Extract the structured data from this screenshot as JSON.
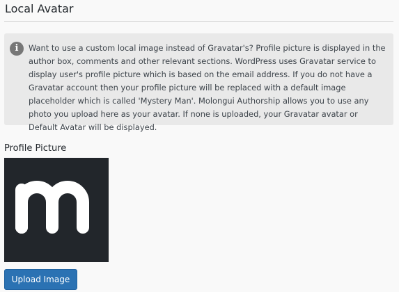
{
  "section": {
    "title": "Local Avatar"
  },
  "notice": {
    "icon": "info-icon",
    "icon_glyph": "i",
    "text": "Want to use a custom local image instead of Gravatar's? Profile picture is displayed in the author box, comments and other relevant sections. WordPress uses Gravatar service to display user's profile picture which is based on the email address. If you do not have a Gravatar account then your profile picture will be replaced with a default image placeholder which is called 'Mystery Man'. Molongui Authorship allows you to use any photo you upload here as your avatar. If none is uploaded, your Gravatar avatar or Default Avatar will be displayed."
  },
  "profile_picture": {
    "label": "Profile Picture",
    "image": "molongui-logo",
    "background_color": "#22262b",
    "logo_color": "#ffffff"
  },
  "upload_button": {
    "label": "Upload Image",
    "color": "#2b72b3"
  }
}
